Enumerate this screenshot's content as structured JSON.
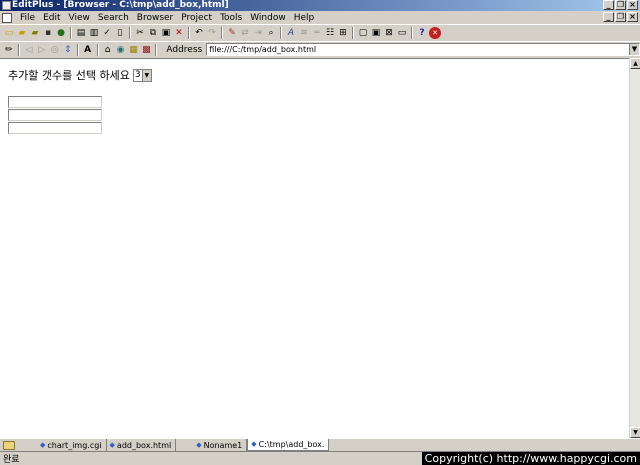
{
  "window": {
    "title": "EditPlus - [Browser - C:\\tmp\\add_box,html]"
  },
  "menu": {
    "items": [
      "File",
      "Edit",
      "View",
      "Search",
      "Browser",
      "Project",
      "Tools",
      "Window",
      "Help"
    ]
  },
  "address": {
    "label": "Address",
    "value": "file:///C:/tmp/add_box.html"
  },
  "page": {
    "prompt": "추가할 갯수를 선택 하세요",
    "select_value": "3",
    "box_count": 3
  },
  "tabs": [
    {
      "label": "chart_img.cgi",
      "active": false
    },
    {
      "label": "add_box.html",
      "active": false
    },
    {
      "label": "Noname1",
      "active": false
    },
    {
      "label": "C:\\tmp\\add_box.",
      "active": true
    }
  ],
  "status": {
    "text": "완료"
  },
  "copyright": "Copyright(c) http://www.happycgi.com",
  "colors": {
    "title_start": "#0a246a",
    "title_end": "#a6caf0",
    "chrome": "#d4d0c8"
  }
}
